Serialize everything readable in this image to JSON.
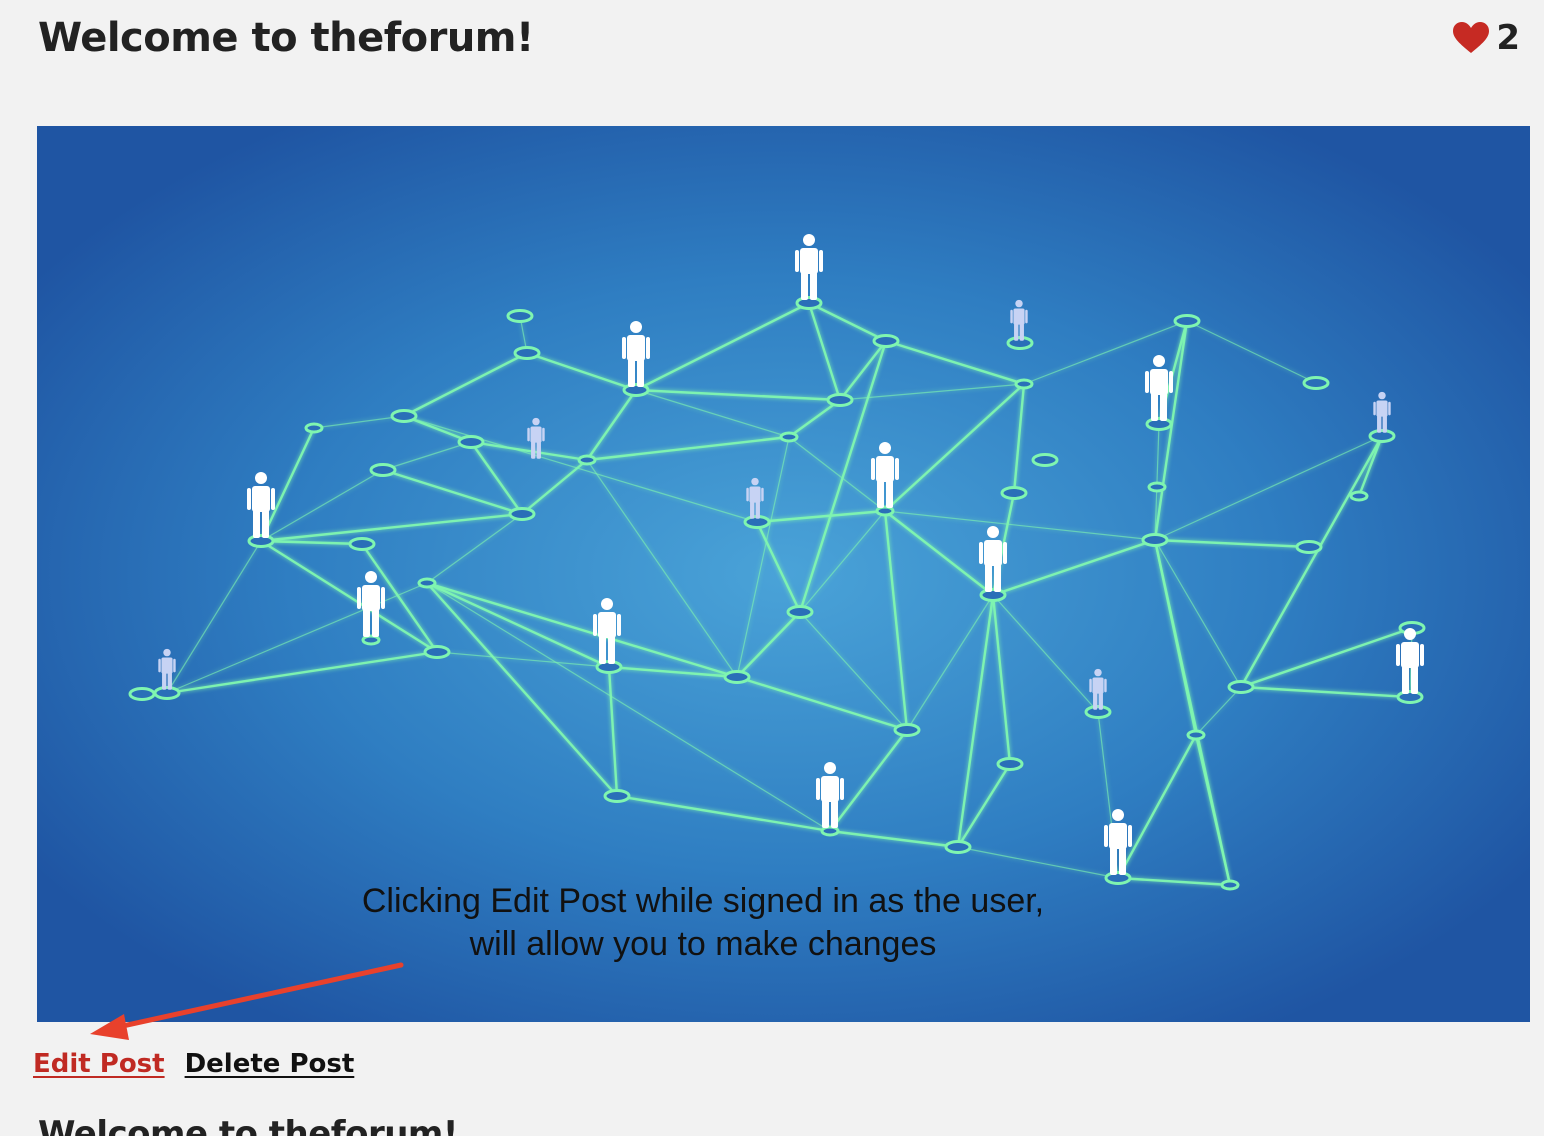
{
  "post": {
    "title": "Welcome to theforum!",
    "like_count": "2",
    "like_icon": "heart-icon",
    "like_color": "#c62a23",
    "image": {
      "description_icon": "network-people-illustration",
      "background_color": "#2a6fb8",
      "line_color": "#7ff5b0",
      "caption_line1": "Clicking Edit Post while signed in as the user,",
      "caption_line2": "will allow you to make changes"
    },
    "actions": {
      "edit_label": "Edit Post",
      "delete_label": "Delete Post"
    },
    "body_heading": "Welcome to theforum!"
  },
  "annotation": {
    "arrow_color": "#e8412c"
  }
}
